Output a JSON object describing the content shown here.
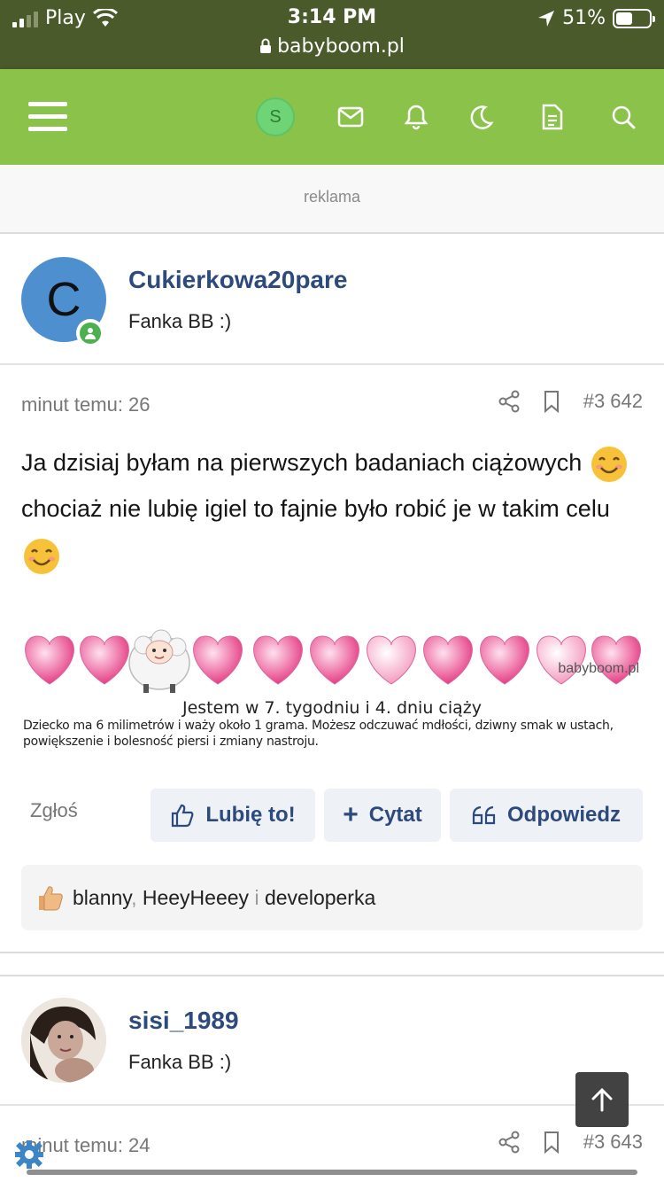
{
  "status": {
    "carrier": "Play",
    "time": "3:14 PM",
    "battery": "51%",
    "battery_level": 0.51,
    "url": "babyboom.pl"
  },
  "nav": {
    "avatar_letter": "S",
    "icons": [
      "menu-icon",
      "avatar",
      "mail-icon",
      "bell-icon",
      "moon-icon",
      "document-icon",
      "search-icon"
    ]
  },
  "ad_label": "reklama",
  "posts": [
    {
      "avatar_letter": "C",
      "username": "Cukierkowa20pare",
      "user_title": "Fanka BB :)",
      "time": "minut temu: 26",
      "post_number": "#3 642",
      "message_parts": [
        "Ja dzisiaj byłam na pierwszych badaniach ciążowych",
        "chociaż nie lubię igiel to fajnie było robić je w takim celu"
      ],
      "signature": {
        "brand": "babyboom.pl",
        "line1": "Jestem w 7. tygodniu i 4. dniu ciąży",
        "line2": "Dziecko ma 6 milimetrów i waży około 1 grama. Możesz odczuwać mdłości, dziwny smak w ustach, powiększenie i bolesność piersi i zmiany nastroju."
      },
      "report_label": "Zgłoś",
      "like_label": "Lubię to!",
      "quote_label": "Cytat",
      "reply_label": "Odpowiedz",
      "likes": {
        "users": [
          "blanny",
          "HeeyHeeey",
          "developerka"
        ],
        "comma": ",",
        "conjunction": "i"
      }
    },
    {
      "username": "sisi_1989",
      "user_title": "Fanka BB :)",
      "time": "minut temu: 24",
      "post_number": "#3 643"
    }
  ],
  "colors": {
    "nav_green": "#8bc34a",
    "status_bg": "#4a5a2a",
    "link_blue": "#2d4a7c"
  }
}
